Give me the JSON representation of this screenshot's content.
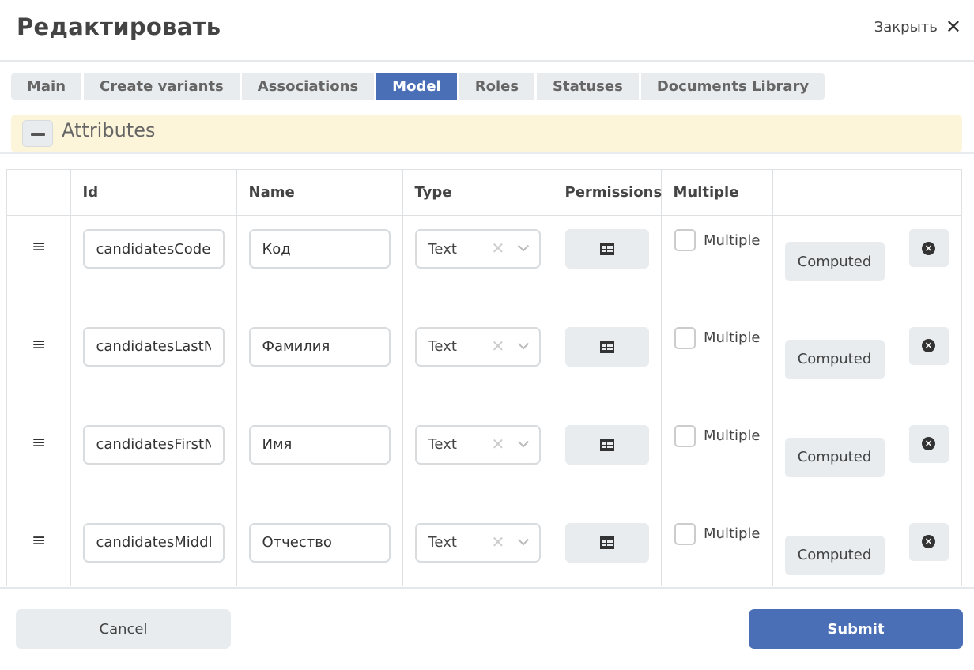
{
  "header": {
    "title": "Редактировать",
    "close_label": "Закрыть",
    "close_icon": "close-icon"
  },
  "tabs": [
    {
      "label": "Main",
      "active": false
    },
    {
      "label": "Create variants",
      "active": false
    },
    {
      "label": "Associations",
      "active": false
    },
    {
      "label": "Model",
      "active": true
    },
    {
      "label": "Roles",
      "active": false
    },
    {
      "label": "Statuses",
      "active": false
    },
    {
      "label": "Documents Library",
      "active": false
    }
  ],
  "section": {
    "title": "Attributes",
    "toggle_icon": "minus-icon"
  },
  "table": {
    "columns": [
      "",
      "Id",
      "Name",
      "Type",
      "Permissions",
      "Multiple",
      "",
      ""
    ],
    "rows": [
      {
        "id": "candidatesCode",
        "name": "Код",
        "type": "Text",
        "multiple": false
      },
      {
        "id": "candidatesLastName",
        "name": "Фамилия",
        "type": "Text",
        "multiple": false
      },
      {
        "id": "candidatesFirstName",
        "name": "Имя",
        "type": "Text",
        "multiple": false
      },
      {
        "id": "candidatesMiddleName",
        "name": "Отчество",
        "type": "Text",
        "multiple": false
      }
    ],
    "multiple_label": "Multiple",
    "computed_label": "Computed",
    "icons": {
      "drag": "drag-handle-icon",
      "permissions": "table-icon",
      "remove": "remove-circle-icon",
      "clear": "clear-icon",
      "dropdown": "chevron-down-icon"
    }
  },
  "footer": {
    "cancel_label": "Cancel",
    "submit_label": "Submit"
  },
  "colors": {
    "accent": "#4a6fb7",
    "section_bg": "#fdf5d9",
    "button_bg": "#e8ecef"
  }
}
